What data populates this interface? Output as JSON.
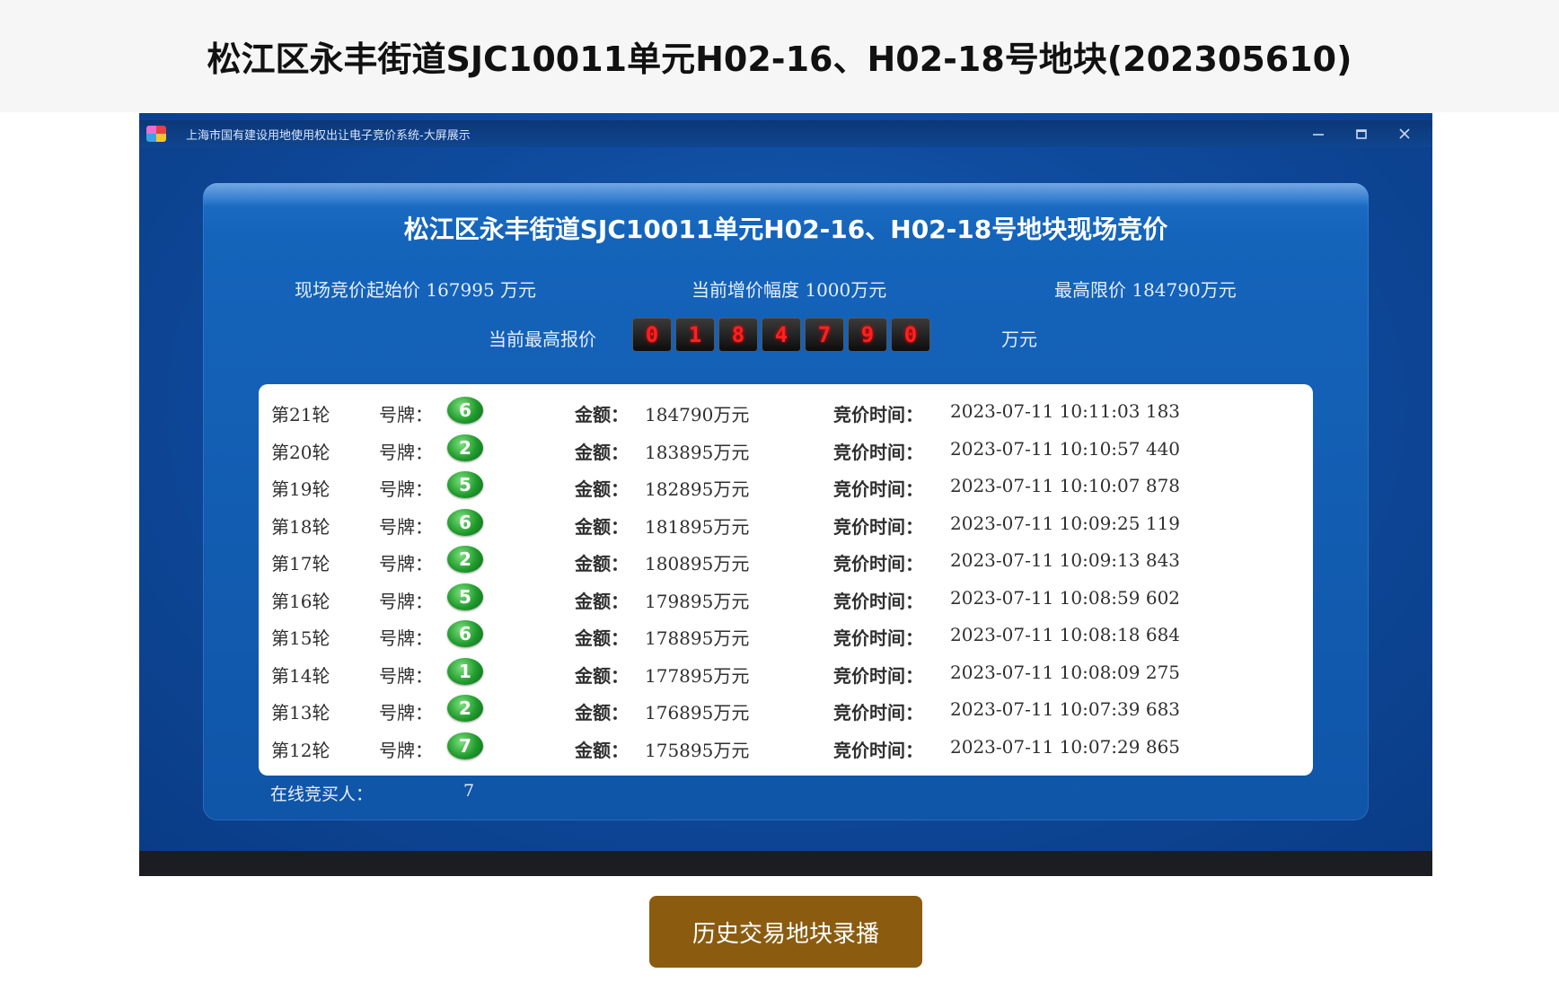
{
  "page": {
    "title": "松江区永丰街道SJC10011单元H02-16、H02-18号地块(202305610)",
    "history_button": "历史交易地块录播"
  },
  "window": {
    "title": "上海市国有建设用地使用权出让电子竞价系统-大屏展示",
    "controls": [
      "minimize-icon",
      "maximize-icon",
      "close-icon"
    ]
  },
  "board": {
    "title": "松江区永丰街道SJC10011单元H02-16、H02-18号地块现场竞价",
    "start_price": "现场竞价起始价 167995 万元",
    "increment": "当前增价幅度 1000万元",
    "max_price": "最高限价 184790万元",
    "current_label": "当前最高报价",
    "current_digits": [
      "0",
      "1",
      "8",
      "4",
      "7",
      "9",
      "0"
    ],
    "current_unit": "万元",
    "plate_label": "号牌：",
    "amount_label": "金额：",
    "time_label": "竞价时间：",
    "bids": [
      {
        "round": "第21轮",
        "plate": "6",
        "amount": "184790万元",
        "time": "2023-07-11 10:11:03 183"
      },
      {
        "round": "第20轮",
        "plate": "2",
        "amount": "183895万元",
        "time": "2023-07-11 10:10:57 440"
      },
      {
        "round": "第19轮",
        "plate": "5",
        "amount": "182895万元",
        "time": "2023-07-11 10:10:07 878"
      },
      {
        "round": "第18轮",
        "plate": "6",
        "amount": "181895万元",
        "time": "2023-07-11 10:09:25 119"
      },
      {
        "round": "第17轮",
        "plate": "2",
        "amount": "180895万元",
        "time": "2023-07-11 10:09:13 843"
      },
      {
        "round": "第16轮",
        "plate": "5",
        "amount": "179895万元",
        "time": "2023-07-11 10:08:59 602"
      },
      {
        "round": "第15轮",
        "plate": "6",
        "amount": "178895万元",
        "time": "2023-07-11 10:08:18 684"
      },
      {
        "round": "第14轮",
        "plate": "1",
        "amount": "177895万元",
        "time": "2023-07-11 10:08:09 275"
      },
      {
        "round": "第13轮",
        "plate": "2",
        "amount": "176895万元",
        "time": "2023-07-11 10:07:39 683"
      },
      {
        "round": "第12轮",
        "plate": "7",
        "amount": "175895万元",
        "time": "2023-07-11 10:07:29 865"
      }
    ],
    "online_label": "在线竞买人：",
    "online_count": "7"
  }
}
